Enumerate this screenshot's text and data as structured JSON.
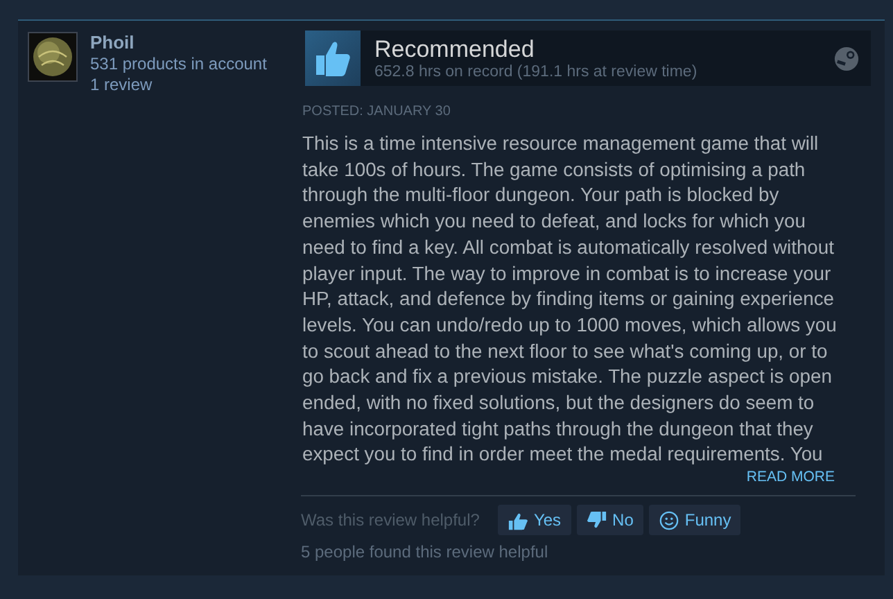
{
  "reviewer": {
    "name": "Phoil",
    "products": "531 products in account",
    "reviews": "1 review"
  },
  "review": {
    "verdict": "Recommended",
    "recommended": true,
    "hours": "652.8 hrs on record (191.1 hrs at review time)",
    "posted": "POSTED: JANUARY 30",
    "text": "This is a time intensive resource management game that will take 100s of hours. The game consists of optimising a path through the multi-floor dungeon. Your path is blocked by enemies which you need to defeat, and locks for which you need to find a key. All combat is automatically resolved without player input. The way to improve in combat is to increase your HP, attack, and defence by finding items or gaining experience levels. You can undo/redo up to 1000 moves, which allows you to scout ahead to the next floor to see what's coming up, or to go back and fix a previous mistake. The puzzle aspect is open ended, with no fixed solutions, but the designers do seem to have incorporated tight paths through the dungeon that they expect you to find in order meet the medal requirements. You",
    "read_more": "READ MORE"
  },
  "helpful": {
    "question": "Was this review helpful?",
    "buttons": [
      {
        "kind": "yes",
        "label": "Yes"
      },
      {
        "kind": "no",
        "label": "No"
      },
      {
        "kind": "funny",
        "label": "Funny"
      }
    ],
    "summary": "5 people found this review helpful"
  }
}
